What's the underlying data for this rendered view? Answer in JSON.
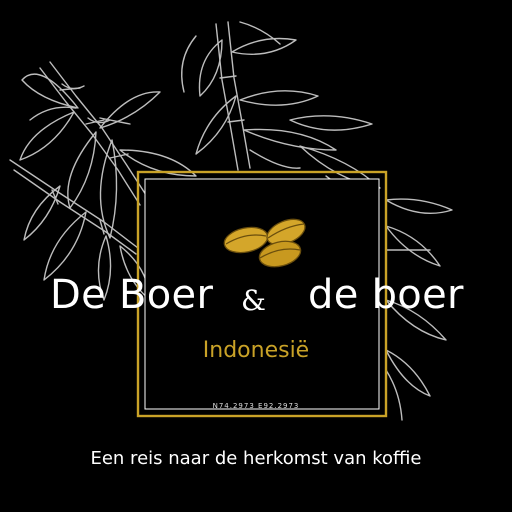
{
  "brand": {
    "left": "De Boer",
    "ampersand": "&",
    "right": "de boer",
    "subtitle": "Indonesië",
    "coordinates": "N74.2973   E92.2973"
  },
  "tagline": "Een reis naar de herkomst van koffie",
  "colors": {
    "background": "#000000",
    "accent_gold": "#c9a227",
    "text": "#ffffff",
    "line_art": "#bdbdbd"
  },
  "icons": [
    "bamboo-line-art",
    "coffee-beans-icon"
  ]
}
